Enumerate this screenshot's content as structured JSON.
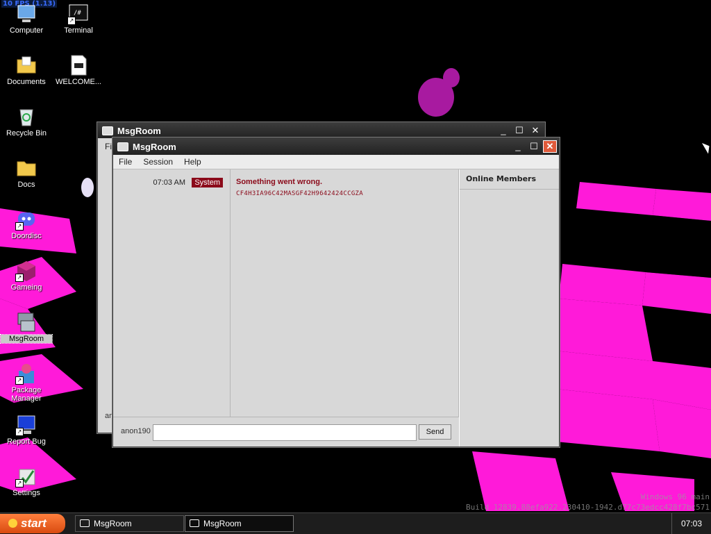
{
  "desktop": {
    "fps": "10 FPS (1.13)",
    "icons": [
      {
        "label": "Computer",
        "icon": "computer-icon"
      },
      {
        "label": "Terminal",
        "icon": "terminal-icon"
      },
      {
        "label": "Documents",
        "icon": "documents-icon"
      },
      {
        "label": "WELCOME...",
        "icon": "markdown-file-icon"
      },
      {
        "label": "Recycle Bin",
        "icon": "recycle-bin-icon"
      },
      {
        "label": "Docs",
        "icon": "folder-icon"
      },
      {
        "label": "Doordisc",
        "icon": "discord-icon"
      },
      {
        "label": "Gameing",
        "icon": "cube-icon"
      },
      {
        "label": "MsgRoom",
        "icon": "msgroom-icon"
      },
      {
        "label": "Package Manager",
        "icon": "package-manager-icon"
      },
      {
        "label": "Report Bug",
        "icon": "report-bug-icon"
      },
      {
        "label": "Settings",
        "icon": "settings-icon"
      }
    ],
    "watermark_line1": "Windows 96 main",
    "watermark_line2": "Build 12839.88efa922.230410-1942.d77c73edcc428f7bc571"
  },
  "back_window": {
    "title": "MsgRoom",
    "menu_fragment": "Fi",
    "nick_fragment": "an"
  },
  "window": {
    "title": "MsgRoom",
    "menu": [
      "File",
      "Session",
      "Help"
    ],
    "message": {
      "time": "07:03 AM",
      "user": "System",
      "text": "Something went wrong.",
      "code": "CF4H3IA96C42MASGF42H9642424CCGZA"
    },
    "members_heading": "Online Members",
    "nickname": "anon190",
    "input_placeholder": "",
    "send_label": "Send"
  },
  "taskbar": {
    "start_label": "start",
    "tasks": [
      "MsgRoom",
      "MsgRoom"
    ],
    "clock": "07:03"
  },
  "colors": {
    "accent": "#8b0a1a",
    "checker": "#ff1ad9",
    "start": "#e8621f"
  }
}
